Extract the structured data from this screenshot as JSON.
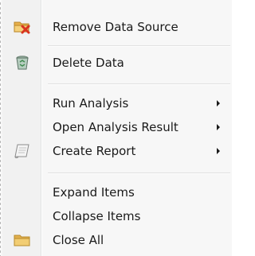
{
  "menu": {
    "items": [
      {
        "label": "Remove Data Source",
        "icon": "folder-remove-icon"
      },
      {
        "label": "Delete Data",
        "icon": "recycle-bin-icon"
      },
      {
        "label": "Run Analysis",
        "has_submenu": true
      },
      {
        "label": "Open Analysis Result",
        "has_submenu": true
      },
      {
        "label": "Create Report",
        "icon": "report-icon",
        "has_submenu": true
      },
      {
        "label": "Expand Items"
      },
      {
        "label": "Collapse Items"
      },
      {
        "label": "Close All",
        "icon": "folder-icon"
      }
    ]
  },
  "colors": {
    "menu_background": "#f7f7f7",
    "gutter_background": "#f1f1f1",
    "text": "#1a1a1a",
    "separator": "#e0e0e0",
    "remove_x": "#d9331f",
    "folder": "#f0c15a"
  }
}
